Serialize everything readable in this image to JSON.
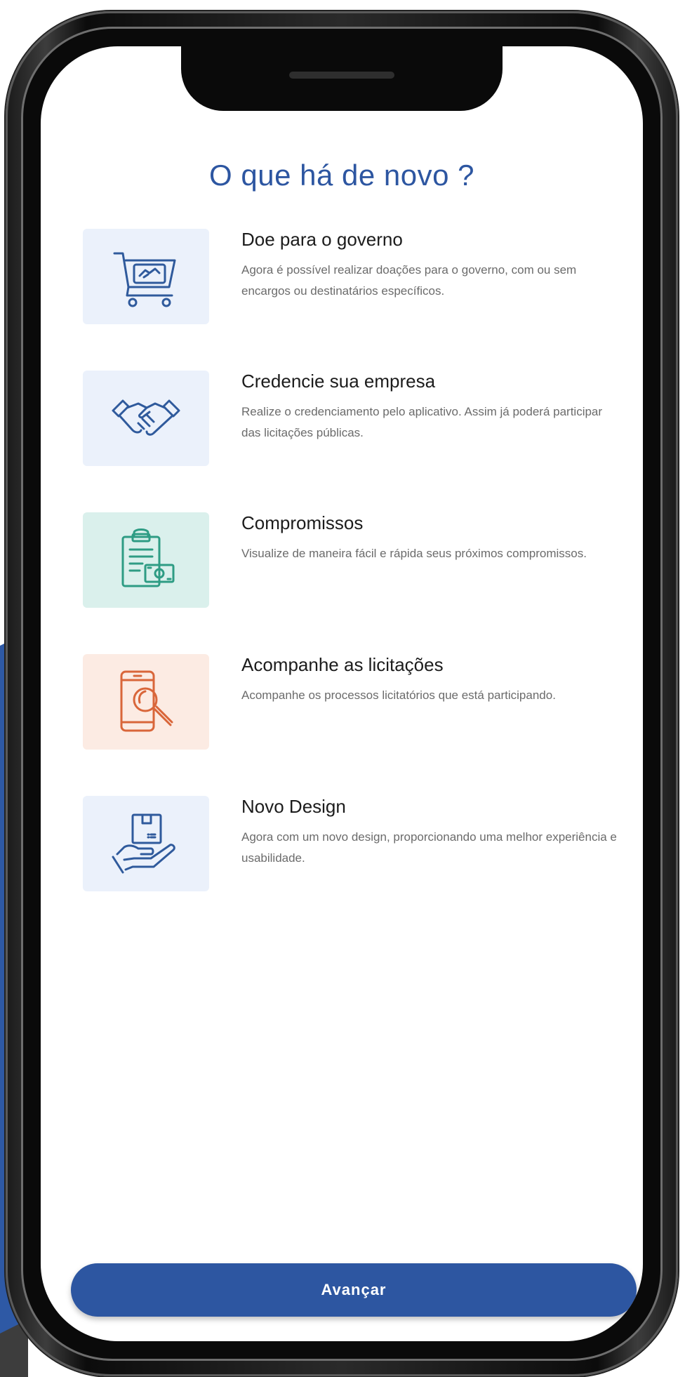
{
  "colors": {
    "brand_blue": "#2d56a1",
    "icon_blue_bg": "#ebf1fb",
    "icon_green_bg": "#daf0ec",
    "icon_orange_bg": "#fcebe3",
    "icon_blue": "#2f5a9c",
    "icon_green": "#2e9c84",
    "icon_orange": "#d9663a"
  },
  "header": {
    "title": "O que há de novo ?"
  },
  "items": [
    {
      "title": "Doe para o governo",
      "description": "Agora é possível realizar doações para o governo, com ou sem encargos ou destinatários específicos.",
      "icon": "donation-cart-icon"
    },
    {
      "title": "Credencie sua empresa",
      "description": "Realize o credenciamento pelo aplicativo. Assim já poderá participar das licitações públicas.",
      "icon": "handshake-icon"
    },
    {
      "title": "Compromissos",
      "description": "Visualize de maneira fácil e rápida seus próximos compromissos.",
      "icon": "clipboard-money-icon"
    },
    {
      "title": "Acompanhe as licitações",
      "description": "Acompanhe os processos licitatórios que está participando.",
      "icon": "phone-search-icon"
    },
    {
      "title": "Novo Design",
      "description": "Agora com um novo design, proporcionando uma melhor experiência e usabilidade.",
      "icon": "hand-package-icon"
    }
  ],
  "footer": {
    "button_label": "Avançar"
  }
}
